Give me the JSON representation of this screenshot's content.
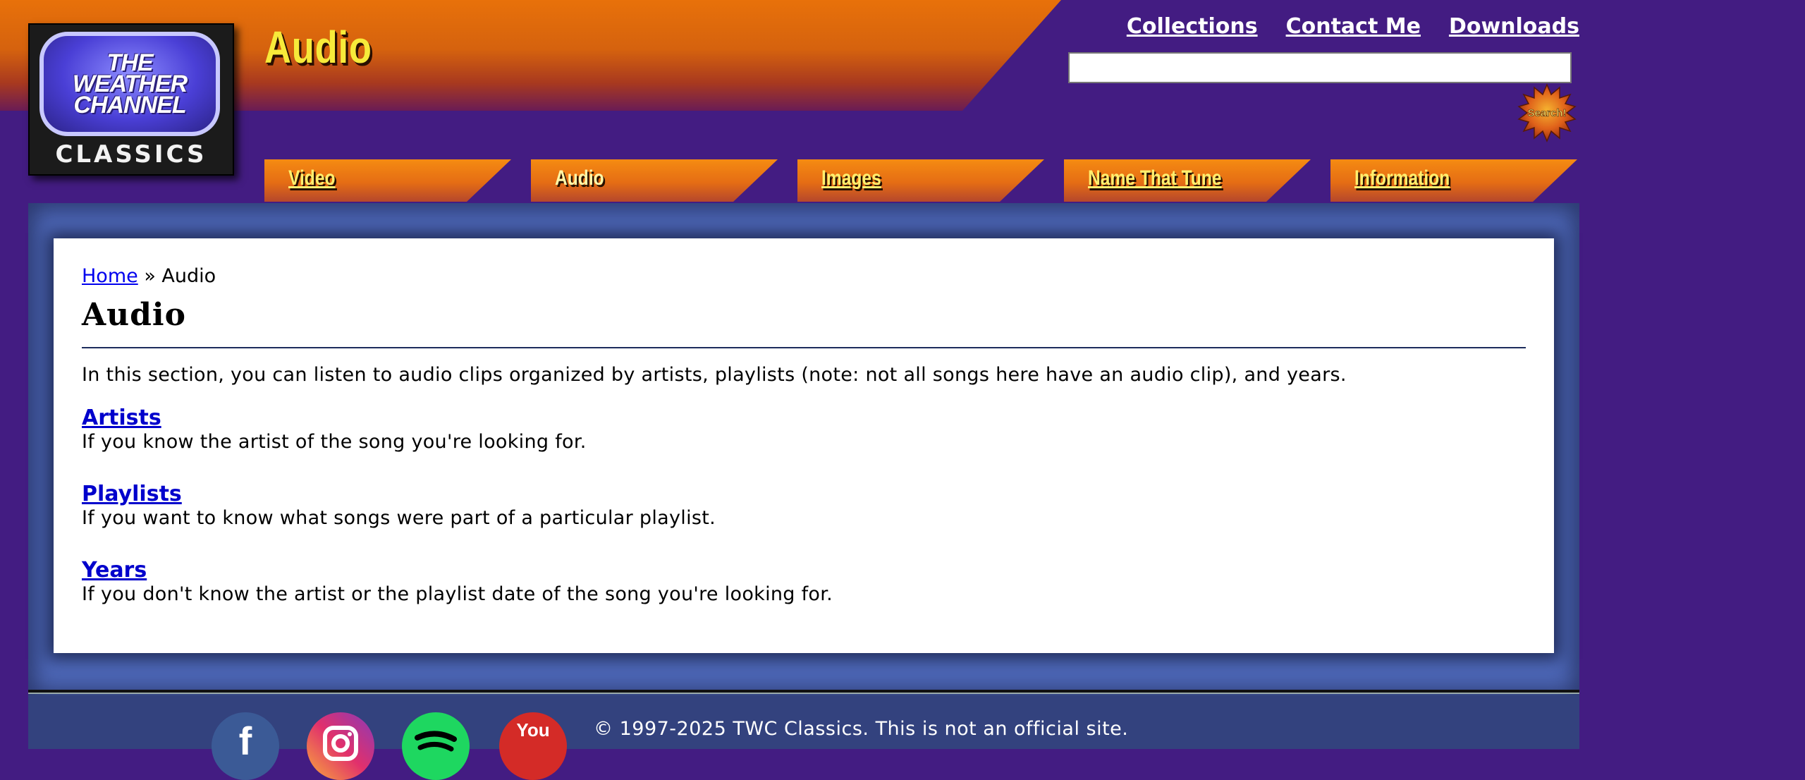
{
  "logo": {
    "line1": "THE",
    "line2": "WEATHER",
    "line3": "CHANNEL",
    "classics": "CLASSICS"
  },
  "header": {
    "page_heading": "Audio",
    "top_links": [
      "Collections",
      "Contact Me",
      "Downloads"
    ],
    "search": {
      "value": "",
      "button_label": "Search!"
    }
  },
  "nav": {
    "tabs": [
      {
        "label": "Video",
        "active": false
      },
      {
        "label": "Audio",
        "active": true
      },
      {
        "label": "Images",
        "active": false
      },
      {
        "label": "Name That Tune",
        "active": false
      },
      {
        "label": "Information",
        "active": false
      }
    ]
  },
  "main": {
    "breadcrumb": {
      "home": "Home",
      "separator": " » ",
      "current": "Audio"
    },
    "title": "Audio",
    "intro": "In this section, you can listen to audio clips organized by artists, playlists (note: not all songs here have an audio clip), and years.",
    "sections": [
      {
        "link": "Artists",
        "description": "If you know the artist of the song you're looking for."
      },
      {
        "link": "Playlists",
        "description": "If you want to know what songs were part of a particular playlist."
      },
      {
        "link": "Years",
        "description": "If you don't know the artist or the playlist date of the song you're looking for."
      }
    ]
  },
  "footer": {
    "copyright": "© 1997-2025 TWC Classics. This is not an official site.",
    "social_icons": [
      "facebook-icon",
      "instagram-icon",
      "spotify-icon",
      "youtube-icon"
    ],
    "youtube_text": "You"
  },
  "colors": {
    "background": "#431c82",
    "banner_orange": "#e8710a",
    "heading_yellow": "#f7ea3a",
    "frame_blue": "#4e68b8",
    "link_blue": "#0000cc",
    "footer_blue": "#33427e"
  }
}
